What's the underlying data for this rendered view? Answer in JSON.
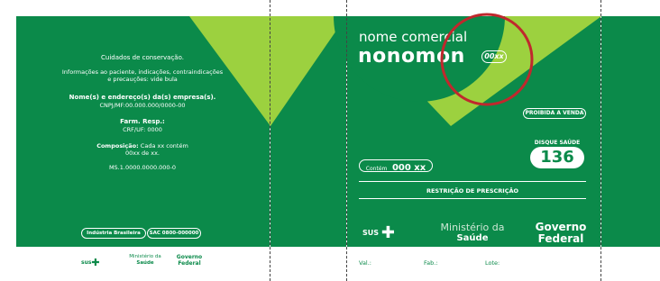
{
  "left_panel": {
    "care_title": "Cuidados de conservação.",
    "info_text_line1": "Informações ao paciente, indicações, contraindicações",
    "info_text_line2": "e precauções: vide bula",
    "company_label": "Nome(s) e endereço(s) da(s) empresa(s).",
    "cnpj": "CNPJ/MF:00.000.000/0000-00",
    "farm_label": "Farm. Resp.:",
    "crf": "CRF/UF: 0000",
    "composition_label": "Composição:",
    "composition_text1": "Cada xx contém",
    "composition_text2": "00xx de xx.",
    "ms_number": "MS.1.0000.0000.000-0",
    "industria_badge": "Indústria Brasileira",
    "sac_badge": "SAC 0800-000000",
    "footer_sus": "sus",
    "footer_ministerio_top": "Ministério da",
    "footer_ministerio_bottom": "Saúde",
    "footer_governo_top": "Governo",
    "footer_governo_bottom": "Federal"
  },
  "front_panel": {
    "commercial_name": "nome comercial",
    "product_name": "nonomon",
    "dose_badge": "00xx",
    "proibida": "PROIBIDA A VENDA",
    "disque_label": "DISQUE SAÚDE",
    "disque_number": "136",
    "contem_label": "Contém",
    "contem_value": "000 xx",
    "restricao": "RESTRIÇÃO DE PRESCRIÇÃO",
    "sus_label": "SUS",
    "ministerio_top": "Ministério da",
    "ministerio_bottom": "Saúde",
    "governo_top": "Governo",
    "governo_bottom": "Federal",
    "val_label": "Val.:",
    "fab_label": "Fab.:",
    "lote_label": "Lote:"
  },
  "colors": {
    "brand_green": "#0b8a4a",
    "light_green": "#9cd13f",
    "circle_red": "#c0282d"
  }
}
